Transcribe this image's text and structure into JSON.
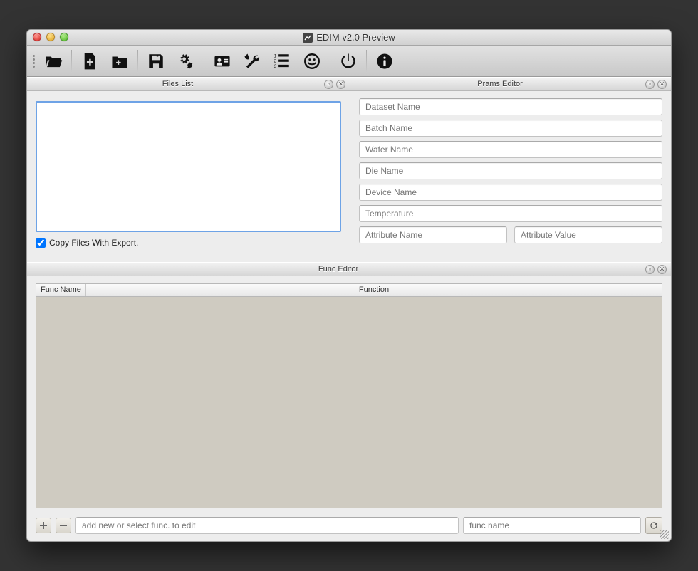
{
  "window": {
    "title": "EDIM v2.0 Preview"
  },
  "toolbar": {
    "icons": [
      "open",
      "new-file",
      "new-folder",
      "save",
      "gears",
      "contact",
      "tools",
      "numbered-list",
      "face",
      "power",
      "info"
    ]
  },
  "panels": {
    "files": {
      "title": "Files List",
      "copy_checkbox_label": "Copy Files With Export.",
      "copy_checked": true
    },
    "prams": {
      "title": "Prams Editor",
      "fields": {
        "dataset": "Dataset Name",
        "batch": "Batch Name",
        "wafer": "Wafer Name",
        "die": "Die Name",
        "device": "Device Name",
        "temperature": "Temperature",
        "attr_name": "Attribute Name",
        "attr_value": "Attribute Value"
      }
    },
    "func": {
      "title": "Func Editor",
      "columns": {
        "name": "Func Name",
        "function": "Function"
      },
      "add_placeholder": "add new or select func. to edit",
      "name_placeholder": "func name"
    }
  }
}
